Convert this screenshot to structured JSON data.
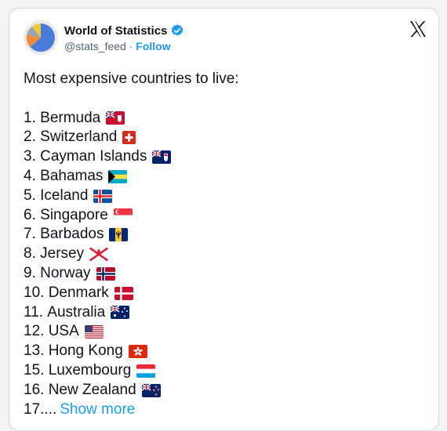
{
  "account": {
    "display_name": "World of Statistics",
    "handle": "@stats_feed",
    "separator": " · ",
    "follow_label": "Follow",
    "verified_color": "#1d9bf0",
    "avatar_icon": "pie-chart-icon"
  },
  "platform": {
    "logo_icon": "x-logo-icon"
  },
  "tweet": {
    "intro": "Most expensive countries to live:",
    "items": [
      {
        "rank": "1.",
        "name": "Bermuda",
        "flag": "bermuda-flag-icon"
      },
      {
        "rank": "2.",
        "name": "Switzerland",
        "flag": "switzerland-flag-icon"
      },
      {
        "rank": "3.",
        "name": "Cayman Islands",
        "flag": "cayman-islands-flag-icon"
      },
      {
        "rank": "4.",
        "name": "Bahamas",
        "flag": "bahamas-flag-icon"
      },
      {
        "rank": "5.",
        "name": "Iceland",
        "flag": "iceland-flag-icon"
      },
      {
        "rank": "6.",
        "name": "Singapore",
        "flag": "singapore-flag-icon"
      },
      {
        "rank": "7.",
        "name": "Barbados",
        "flag": "barbados-flag-icon"
      },
      {
        "rank": "8.",
        "name": "Jersey",
        "flag": "jersey-flag-icon"
      },
      {
        "rank": "9.",
        "name": "Norway",
        "flag": "norway-flag-icon"
      },
      {
        "rank": "10.",
        "name": "Denmark",
        "flag": "denmark-flag-icon"
      },
      {
        "rank": "11.",
        "name": "Australia",
        "flag": "australia-flag-icon"
      },
      {
        "rank": "12.",
        "name": "USA",
        "flag": "usa-flag-icon"
      },
      {
        "rank": "13.",
        "name": "Hong Kong",
        "flag": "hong-kong-flag-icon"
      },
      {
        "rank": "15.",
        "name": "Luxembourg",
        "flag": "luxembourg-flag-icon"
      },
      {
        "rank": "16.",
        "name": "New Zealand",
        "flag": "new-zealand-flag-icon"
      }
    ],
    "truncated_rank": "17....",
    "show_more_label": "Show more"
  },
  "colors": {
    "link": "#1d9bf0",
    "text": "#0f1419",
    "muted": "#536471"
  }
}
